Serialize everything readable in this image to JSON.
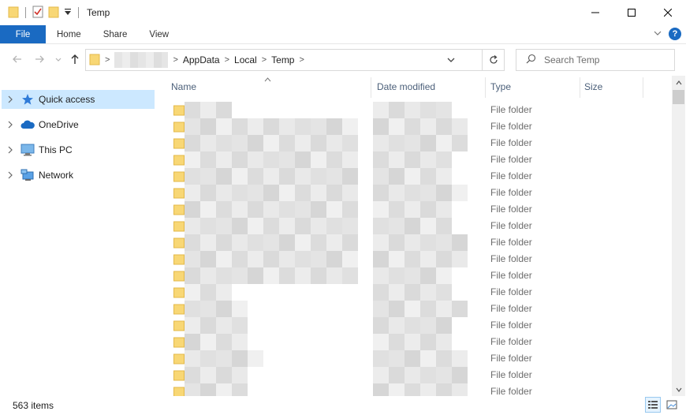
{
  "window": {
    "title": "Temp"
  },
  "ribbon": {
    "tabs": [
      {
        "label": "File"
      },
      {
        "label": "Home"
      },
      {
        "label": "Share"
      },
      {
        "label": "View"
      }
    ],
    "help_label": "?"
  },
  "address": {
    "crumbs": [
      "AppData",
      "Local",
      "Temp"
    ]
  },
  "search": {
    "placeholder": "Search Temp"
  },
  "nav_pane": {
    "items": [
      {
        "label": "Quick access",
        "icon": "star-icon",
        "selected": true
      },
      {
        "label": "OneDrive",
        "icon": "cloud-icon",
        "selected": false
      },
      {
        "label": "This PC",
        "icon": "computer-icon",
        "selected": false
      },
      {
        "label": "Network",
        "icon": "network-icon",
        "selected": false
      }
    ]
  },
  "columns": {
    "name": "Name",
    "date_modified": "Date modified",
    "type": "Type",
    "size": "Size"
  },
  "rows": [
    {
      "type": "File folder"
    },
    {
      "type": "File folder"
    },
    {
      "type": "File folder"
    },
    {
      "type": "File folder"
    },
    {
      "type": "File folder"
    },
    {
      "type": "File folder"
    },
    {
      "type": "File folder"
    },
    {
      "type": "File folder"
    },
    {
      "type": "File folder"
    },
    {
      "type": "File folder"
    },
    {
      "type": "File folder"
    },
    {
      "type": "File folder"
    },
    {
      "type": "File folder"
    },
    {
      "type": "File folder"
    },
    {
      "type": "File folder"
    },
    {
      "type": "File folder"
    },
    {
      "type": "File folder"
    },
    {
      "type": "File folder"
    }
  ],
  "status": {
    "item_count": "563 items"
  },
  "colors": {
    "accent": "#1a6ac2",
    "selection": "#cce8ff",
    "folder": "#f8d775",
    "folder_dark": "#e3b94a"
  }
}
